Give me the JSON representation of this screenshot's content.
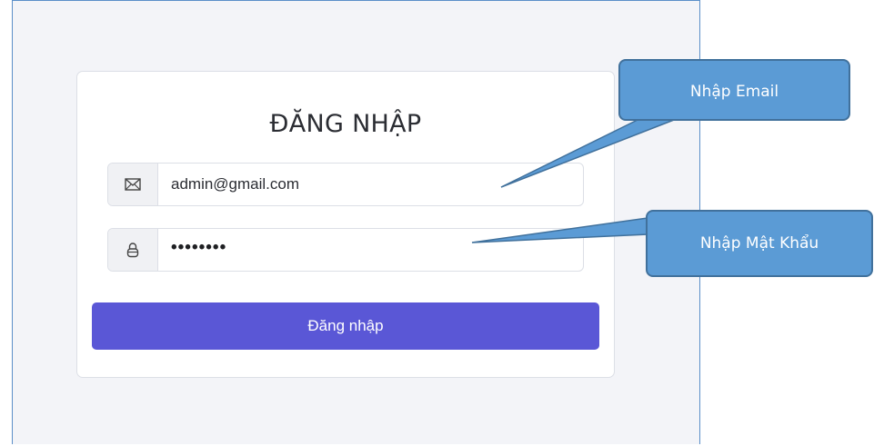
{
  "form": {
    "title": "ĐĂNG NHẬP",
    "email_value": "admin@gmail.com",
    "password_value": "••••••••",
    "submit_label": "Đăng nhập",
    "email_icon": "envelope-icon",
    "password_icon": "lock-icon"
  },
  "annotations": {
    "email_callout": "Nhập Email",
    "password_callout": "Nhập Mật Khẩu",
    "callout_fill": "#5b9bd5",
    "callout_border": "#41719c"
  },
  "colors": {
    "accent": "#5a57d6",
    "background": "#f3f4f8",
    "card": "#ffffff"
  }
}
